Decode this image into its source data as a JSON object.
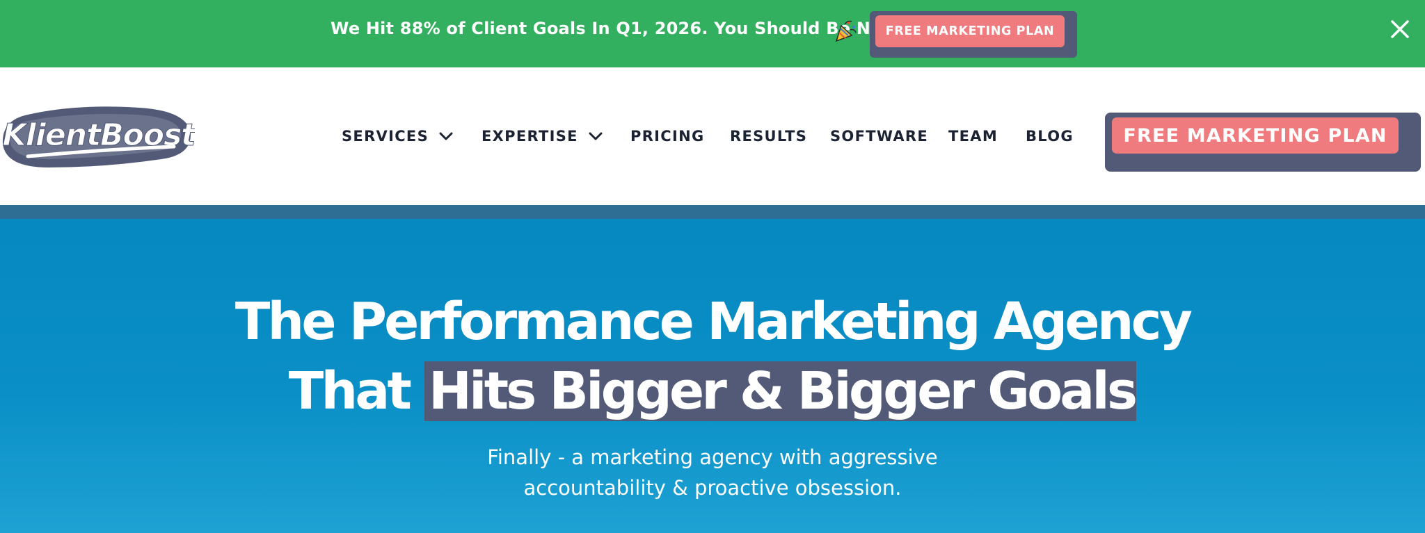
{
  "promo": {
    "message": "We Hit 88% of Client Goals In Q1, 2026. You Should Be Next",
    "emoji": "🎉",
    "emoji_icon": "party-popper-icon",
    "cta_label": "FREE MARKETING PLAN",
    "close_icon": "close-icon"
  },
  "nav": {
    "logo_text": "KlientBoost",
    "items": [
      {
        "label": "SERVICES",
        "has_dropdown": true
      },
      {
        "label": "EXPERTISE",
        "has_dropdown": true
      },
      {
        "label": "PRICING",
        "has_dropdown": false
      },
      {
        "label": "RESULTS",
        "has_dropdown": false
      },
      {
        "label": "SOFTWARE",
        "has_dropdown": false
      },
      {
        "label": "TEAM",
        "has_dropdown": false
      },
      {
        "label": "BLOG",
        "has_dropdown": false
      }
    ],
    "cta_label": "FREE MARKETING PLAN"
  },
  "hero": {
    "headline_line1": "The Performance Marketing Agency",
    "headline_line2_plain": "That ",
    "headline_line2_highlight": "Hits Bigger & Bigger Goals",
    "subheadline_line1": "Finally - a marketing agency with aggressive",
    "subheadline_line2": "accountability & proactive obsession."
  },
  "colors": {
    "promo_bg": "#32b05f",
    "cta_pink": "#ef7b7e",
    "cta_shadow": "#525a78",
    "hero_blue": "#0a8fc6",
    "nav_text": "#1b2333"
  }
}
